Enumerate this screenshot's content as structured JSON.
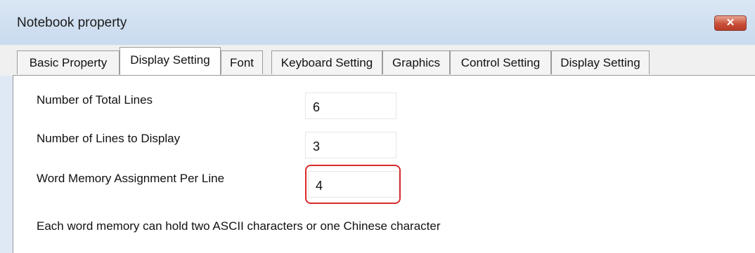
{
  "window": {
    "title": "Notebook property",
    "close_label": "✕"
  },
  "tabs": [
    {
      "label": "Basic Property"
    },
    {
      "label": "Display Setting"
    },
    {
      "label": "Font"
    },
    {
      "label": "Keyboard Setting"
    },
    {
      "label": "Graphics"
    },
    {
      "label": "Control Setting"
    },
    {
      "label": "Display Setting"
    }
  ],
  "form": {
    "total_lines": {
      "label": "Number of Total Lines",
      "value": "6"
    },
    "display_lines": {
      "label": "Number of Lines to Display",
      "value": "3"
    },
    "word_memory": {
      "label": "Word Memory Assignment Per Line",
      "value": "4"
    },
    "note": "Each word memory can hold two ASCII characters or one Chinese character"
  },
  "colors": {
    "highlight": "#d92b2b",
    "close_button": "#c9503a"
  }
}
